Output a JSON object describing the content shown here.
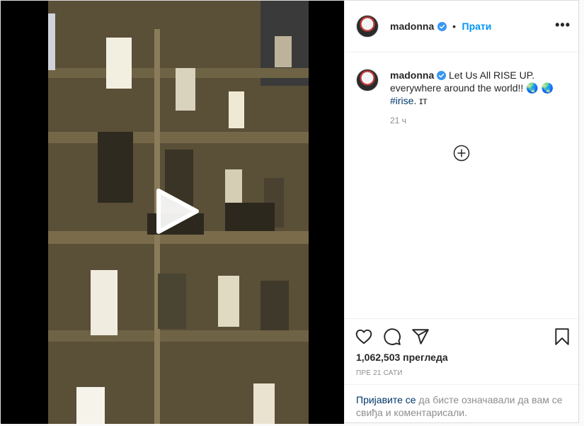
{
  "post": {
    "username": "madonna",
    "follow_label": "Прати",
    "more_label": "•••",
    "caption": {
      "text": "Let Us All RISE UP. everywhere around the world!!",
      "emoji": "🌏 🌏",
      "hashtag": "#irise",
      "suffix": ". ɪᴛ"
    },
    "caption_time": "21 ч",
    "views": "1,062,503 прегледа",
    "posted_ago": "ПРЕ 21 САТИ",
    "login_prompt": {
      "link": "Пријавите се",
      "text": " да бисте означавали да вам се свиђа и коментарисали."
    }
  },
  "icons": {
    "verified": "verified-badge-icon",
    "like": "heart-icon",
    "comment": "comment-icon",
    "share": "share-icon",
    "save": "bookmark-icon",
    "play": "play-icon",
    "load_more": "plus-circle-icon"
  },
  "colors": {
    "accent": "#0095f6",
    "verified": "#3897f0",
    "link": "#00376b",
    "muted": "#8e8e8e"
  }
}
